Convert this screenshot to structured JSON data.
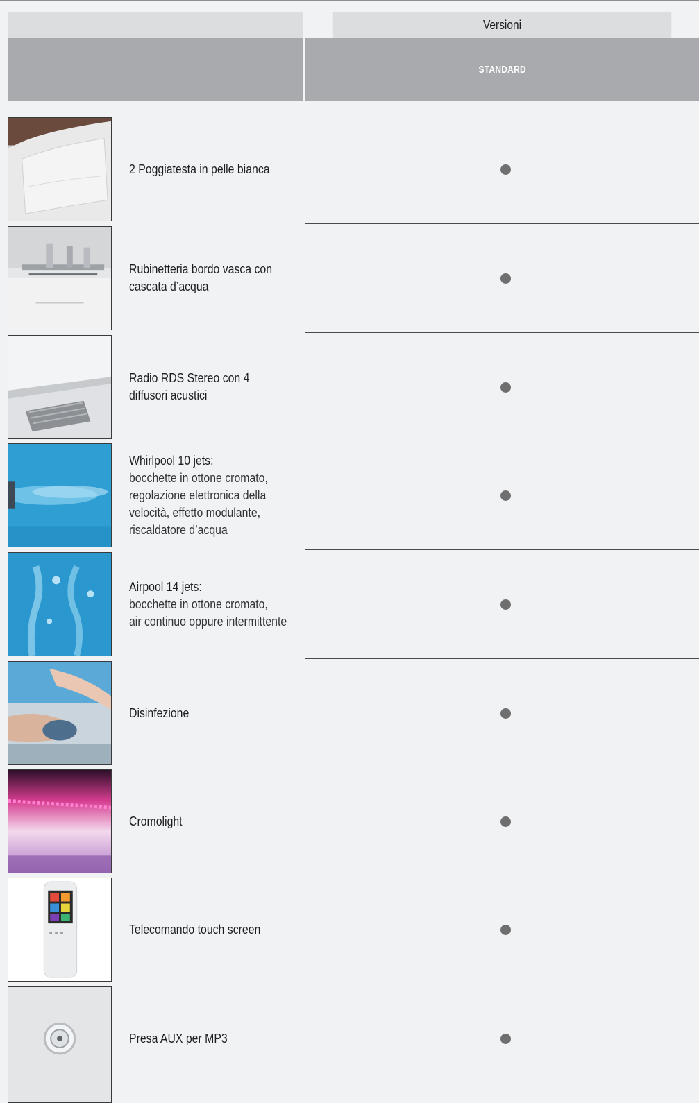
{
  "header": {
    "versions_label": "Versioni",
    "standard_label": "STANDARD"
  },
  "rows": [
    {
      "title": "2 Poggiatesta in pelle bianca",
      "detail": "",
      "value": "●",
      "thumbnail_icon": "headrest-photo"
    },
    {
      "title": "Rubinetteria bordo vasca con\ncascata d’acqua",
      "detail": "",
      "value": "●",
      "thumbnail_icon": "faucet-photo"
    },
    {
      "title": "Radio RDS Stereo con 4\ndiffusori acustici",
      "detail": "",
      "value": "●",
      "thumbnail_icon": "speaker-photo"
    },
    {
      "title": "Whirlpool 10 jets:",
      "detail": "bocchette in ottone cromato,\nregolazione elettronica della\nvelocità, effetto modulante,\nriscaldatore d’acqua",
      "value": "●",
      "thumbnail_icon": "whirlpool-photo"
    },
    {
      "title": "Airpool 14 jets:",
      "detail": "bocchette in ottone cromato,\nair continuo oppure intermittente",
      "value": "●",
      "thumbnail_icon": "airpool-photo"
    },
    {
      "title": "Disinfezione",
      "detail": "",
      "value": "●",
      "thumbnail_icon": "disinfection-photo"
    },
    {
      "title": "Cromolight",
      "detail": "",
      "value": "●",
      "thumbnail_icon": "cromolight-photo"
    },
    {
      "title": "Telecomando touch screen",
      "detail": "",
      "value": "●",
      "thumbnail_icon": "remote-control-photo"
    },
    {
      "title": "Presa AUX per MP3",
      "detail": "",
      "value": "●",
      "thumbnail_icon": "aux-socket-photo"
    }
  ],
  "colors": {
    "background": "#f0f2f4",
    "header_light": "#dcdddf",
    "header_dark": "#a9aaad",
    "dot": "#6f6f6f"
  }
}
